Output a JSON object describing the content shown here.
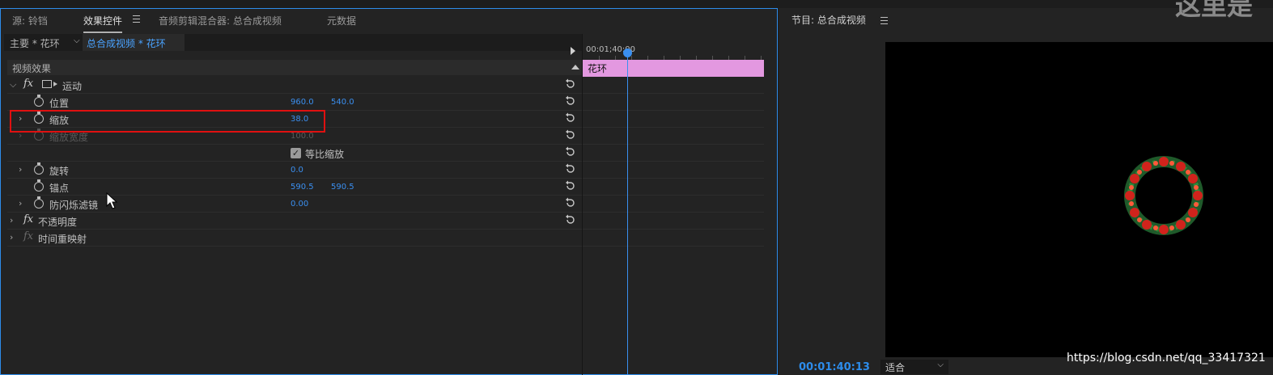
{
  "left_tabs": [
    {
      "label": "源: 铃铛"
    },
    {
      "label": "效果控件"
    },
    {
      "label": "音频剪辑混合器: 总合成视频"
    },
    {
      "label": "元数据"
    }
  ],
  "effect_controls": {
    "master_label": "主要 * 花环",
    "sequence_label": "总合成视频 * 花环",
    "section_label": "视频效果",
    "rows": {
      "motion": {
        "label": "运动"
      },
      "position": {
        "label": "位置",
        "v1": "960.0",
        "v2": "540.0"
      },
      "scale": {
        "label": "缩放",
        "v1": "38.0"
      },
      "scale_width": {
        "label": "缩放宽度",
        "v1": "100.0"
      },
      "uniform": {
        "label": "等比缩放",
        "checked": true
      },
      "rotation": {
        "label": "旋转",
        "v1": "0.0"
      },
      "anchor": {
        "label": "锚点",
        "v1": "590.5",
        "v2": "590.5"
      },
      "flicker": {
        "label": "防闪烁滤镜",
        "v1": "0.00"
      },
      "opacity": {
        "label": "不透明度"
      },
      "time_remap": {
        "label": "时间重映射"
      }
    }
  },
  "timeline": {
    "timecode": "00:01;40:00",
    "clip_label": "花环"
  },
  "program": {
    "title": "节目: 总合成视频",
    "timecode": "00:01:40:13",
    "fit_label": "适合"
  },
  "overlay_text": "这里是",
  "watermark": "https://blog.csdn.net/qq_33417321",
  "colors": {
    "accent": "#2d8ceb",
    "value_blue": "#3a8ff0",
    "clip_pink": "#e398e0",
    "highlight_red": "#e01010"
  }
}
